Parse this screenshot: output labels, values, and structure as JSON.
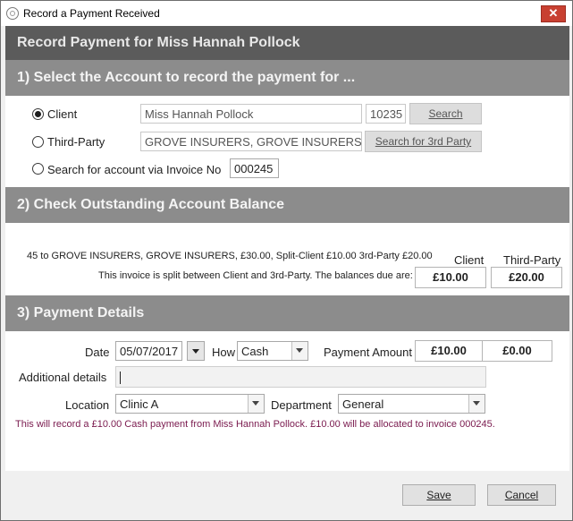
{
  "window": {
    "title": "Record a Payment Received"
  },
  "header": {
    "title": "Record Payment for Miss Hannah Pollock"
  },
  "section1": {
    "title": "1) Select the Account to record the payment for ...",
    "client_label": "Client",
    "client_name": "Miss Hannah Pollock",
    "client_id": "10235",
    "search_label": "Search",
    "third_party_label": "Third-Party",
    "third_party_name": "GROVE INSURERS, GROVE INSURERS",
    "search_third_label": "Search for 3rd Party",
    "invoice_search_label": "Search for account via Invoice No",
    "invoice_no": "000245",
    "selected": "client"
  },
  "section2": {
    "title": "2) Check Outstanding Account Balance",
    "summary": "45 to GROVE INSURERS, GROVE INSURERS, £30.00, Split-Client £10.00 3rd-Party £20.00",
    "split_note": "This invoice is split between Client and 3rd-Party. The balances due are:",
    "client_header": "Client",
    "third_header": "Third-Party",
    "client_balance": "£10.00",
    "third_balance": "£20.00"
  },
  "section3": {
    "title": "3) Payment Details",
    "date_label": "Date",
    "date_value": "05/07/2017",
    "how_label": "How",
    "how_value": "Cash",
    "amount_label": "Payment Amount",
    "amount_client": "£10.00",
    "amount_third": "£0.00",
    "additional_label": "Additional details",
    "additional_value": "",
    "location_label": "Location",
    "location_value": "Clinic A",
    "department_label": "Department",
    "department_value": "General",
    "message": "This will record a £10.00 Cash payment from Miss Hannah Pollock. £10.00 will be allocated to invoice 000245."
  },
  "footer": {
    "save_label": "Save",
    "cancel_label": "Cancel"
  }
}
